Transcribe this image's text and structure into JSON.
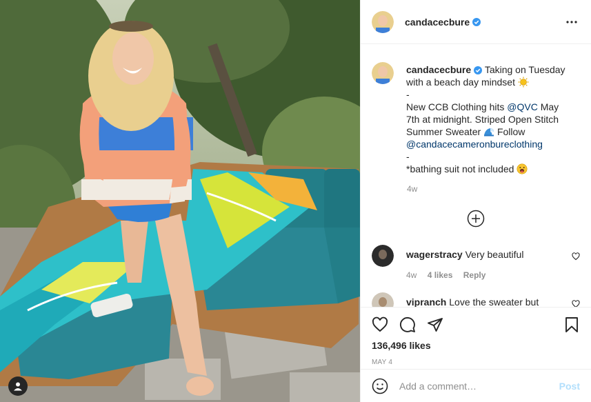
{
  "post": {
    "username": "candacecbure",
    "caption_lines": [
      "Taking on Tuesday",
      "with a beach day mindset",
      "-",
      "New CCB Clothing hits",
      "@QVC",
      "May",
      "7th at midnight. Striped Open Stitch",
      "Summer Sweater",
      "Follow",
      "@candacecameronbureclothing",
      "-",
      "*bathing suit not included"
    ],
    "age": "4w",
    "likes": "136,496 likes",
    "date": "MAY 4"
  },
  "comments": [
    {
      "username": "wagerstracy",
      "text": "Very beautiful",
      "age": "4w",
      "likes": "4 likes",
      "reply": "Reply"
    },
    {
      "username": "vipranch",
      "text": "Love the sweater but",
      "age": "",
      "likes": "",
      "reply": ""
    }
  ],
  "add_comment": {
    "placeholder": "Add a comment…",
    "post_label": "Post"
  },
  "icons": [
    "verified-badge",
    "more-icon",
    "plus-circle-icon",
    "heart-icon",
    "comment-icon",
    "share-icon",
    "bookmark-icon",
    "smile-icon",
    "user-tag-icon"
  ],
  "colors": {
    "link": "#00376b",
    "verified": "#3897f0",
    "post_disabled": "#b2dffc",
    "muted": "#8e8e8e"
  }
}
